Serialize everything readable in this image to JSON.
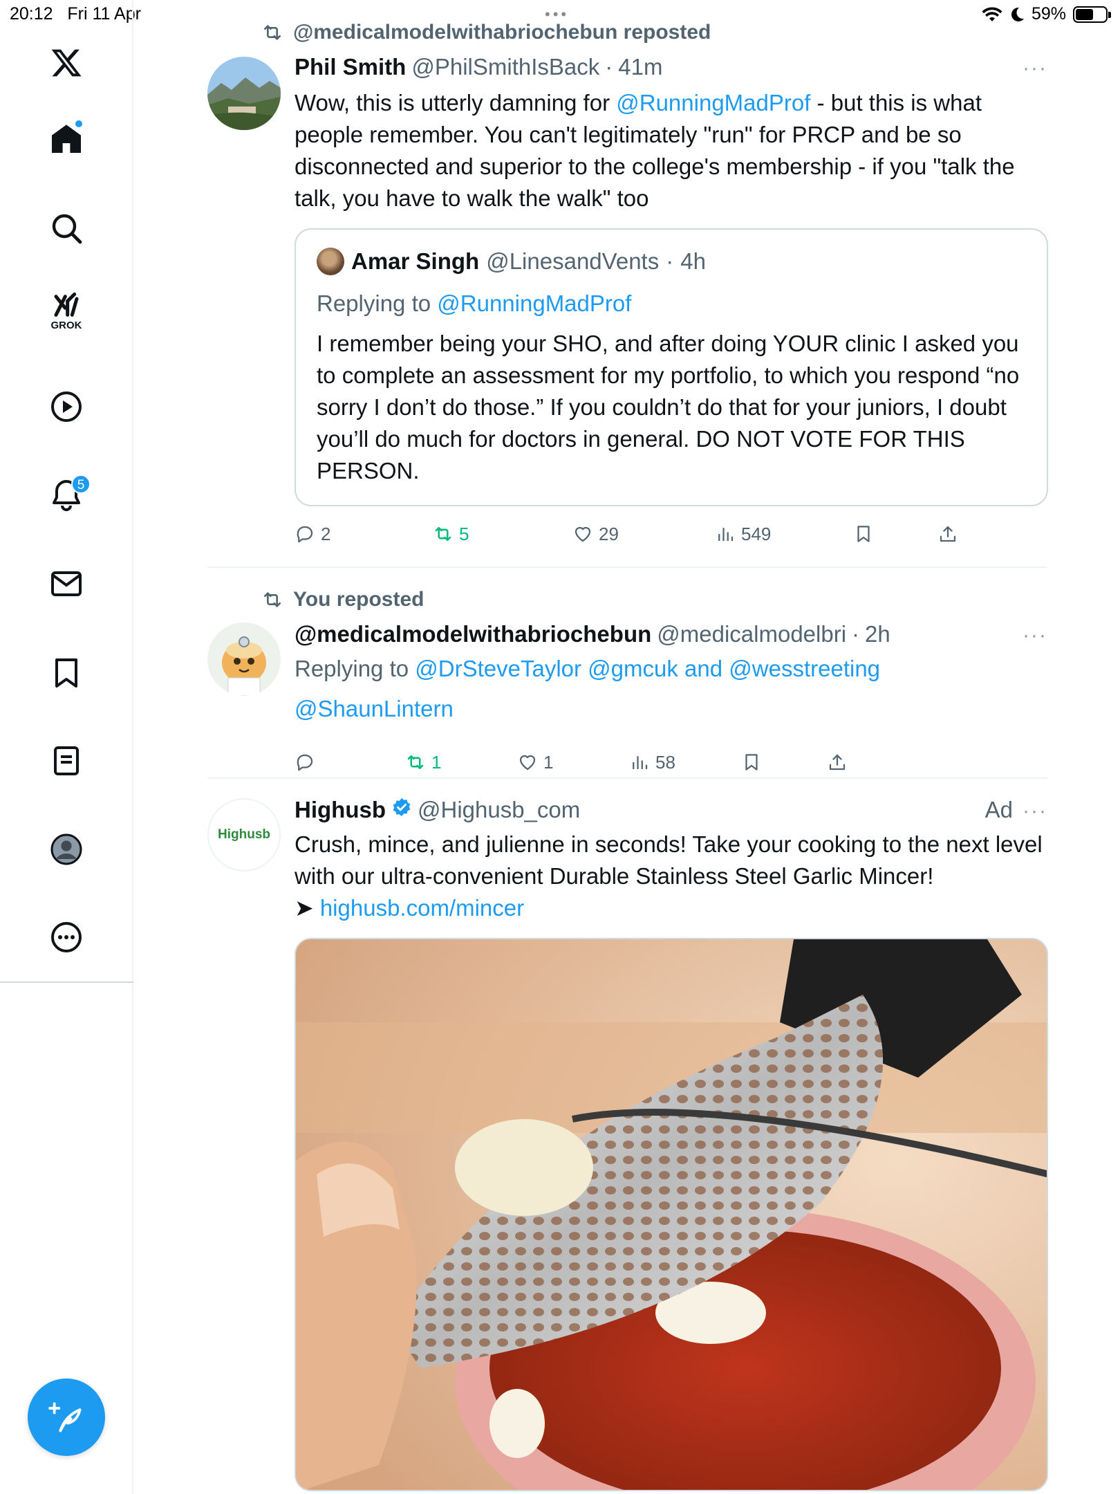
{
  "status_bar": {
    "time": "20:12",
    "date": "Fri 11 Apr",
    "battery": "59%",
    "battery_level": 0.59
  },
  "sidebar": {
    "items": [
      {
        "name": "home",
        "icon": "home-icon",
        "has_dot": true
      },
      {
        "name": "search",
        "icon": "search-icon"
      },
      {
        "name": "grok",
        "icon": "grok-icon",
        "label": "GROK"
      },
      {
        "name": "videos",
        "icon": "play-icon"
      },
      {
        "name": "notifications",
        "icon": "bell-icon",
        "badge": "5"
      },
      {
        "name": "messages",
        "icon": "mail-icon"
      },
      {
        "name": "bookmarks",
        "icon": "bookmark-icon"
      },
      {
        "name": "lists",
        "icon": "list-icon"
      },
      {
        "name": "profile",
        "icon": "profile-icon"
      },
      {
        "name": "more",
        "icon": "more-circle-icon"
      }
    ],
    "compose_icon": "compose-icon",
    "accent": "#1d9bf0"
  },
  "posts": [
    {
      "reposted_by": "@medicalmodelwithabriochebun reposted",
      "name": "Phil Smith",
      "handle": "@PhilSmithIsBack",
      "sep": "·",
      "time": "41m",
      "text_a": "Wow, this is utterly damning for ",
      "mention": "@RunningMadProf",
      "text_b": " - but this is what people remember. You can't legitimately \"run\" for PRCP and be so disconnected and superior to the college's membership - if you \"talk the talk, you have to walk the walk\" too",
      "quote": {
        "name": "Amar Singh",
        "handle": "@LinesandVents",
        "sep": "·",
        "time": "4h",
        "replying_prefix": "Replying to ",
        "replying_to": "@RunningMadProf",
        "text": "I remember being your SHO, and after doing YOUR clinic I asked you to complete an assessment for my portfolio, to which you respond “no sorry I don’t do those.” If you couldn’t do that for your juniors, I doubt you’ll do much for doctors in general. DO NOT VOTE FOR THIS PERSON."
      },
      "stats": {
        "replies": "2",
        "reposts": "5",
        "likes": "29",
        "views": "549"
      }
    },
    {
      "reposted_by": "You reposted",
      "name": "@medicalmodelwithabriochebun",
      "handle": "@medicalmodelbri",
      "sep": "·",
      "time": "2h",
      "replying_prefix": "Replying to ",
      "replying_to_a": "@DrSteveTaylor",
      "replying_to_b": "@gmcuk",
      "replying_and": "and",
      "replying_to_c": "@wesstreeting",
      "extra_mention": "@ShaunLintern",
      "stats": {
        "replies": "",
        "reposts": "1",
        "likes": "1",
        "views": "58"
      }
    },
    {
      "name": "Highusb",
      "avatar_text": "Highusb",
      "handle": "@Highusb_com",
      "ad_label": "Ad",
      "text": "Crush, mince, and julienne in seconds!  Take your cooking to the next level with our ultra-convenient Durable Stainless Steel Garlic Mincer!",
      "arrow": "➤ ",
      "link": "highusb.com/mincer",
      "media_icon": "garlic-mincer-photo"
    }
  ],
  "more_glyph": "···"
}
